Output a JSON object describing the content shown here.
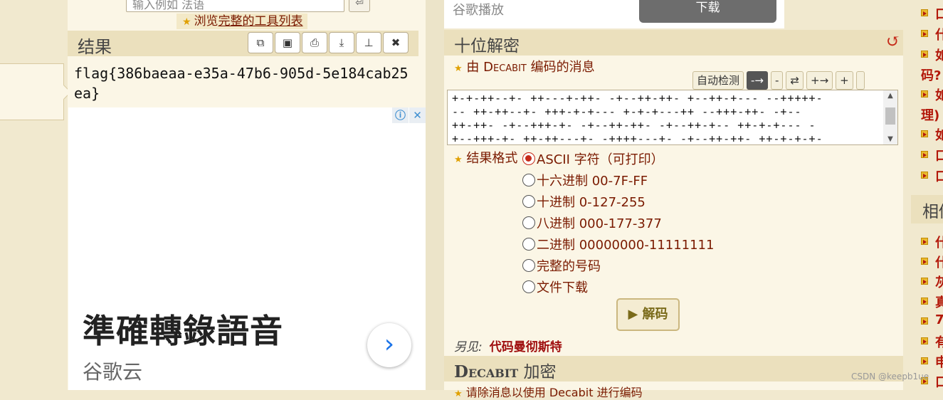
{
  "left_panel": {
    "input_placeholder": "输入例如 法语",
    "input_button_icon": "return-icon",
    "tool_link_prefix": "浏览",
    "tool_link_text": "完整的工具列表",
    "result_title": "结果",
    "result_buttons": [
      "copy-icon",
      "save-icon",
      "print-icon",
      "download-icon",
      "pin-icon",
      "close-icon"
    ],
    "result_text": "flag{386baeaa-e35a-47b6-905d-5e184cab25ea}"
  },
  "ad": {
    "info_icon": "ⓘ",
    "close_icon": "✕",
    "title": "準確轉錄語音",
    "subtitle": "谷歌云",
    "arrow": "›"
  },
  "video_bar": {
    "label": "谷歌播放",
    "download_label": "下载"
  },
  "decode_section": {
    "title": "十位解密",
    "refresh_icon": "↺",
    "message_label_prefix": "由",
    "message_label_brand": "Decabit",
    "message_label_suffix": "编码的消息",
    "controls": {
      "autodetect": "自动检测",
      "arrow_right": "-→",
      "minus": "-",
      "swap": "⇄",
      "plus_arrow": "+→",
      "plus": "+"
    },
    "encoded_text": "+-+-++--+- ++---+-++- -+--++-++- +--++-+--- --+++++-\n-- ++-++--+- +++-+-+--- +-+-+---++ --+++-++- -+--\n++-++- -+--+++-+- -+--++-++- -+--++-+-- ++-+-+--- -\n+--+++-+- ++-++---+- -++++---+- -+--++-++- ++-+-+-+-",
    "format_label": "结果格式",
    "format_options": [
      "ASCII 字符（可打印）",
      "十六进制 00-7F-FF",
      "十进制 0-127-255",
      "八进制 000-177-377",
      "二进制 00000000-11111111",
      "完整的号码",
      "文件下载"
    ],
    "selected_format": 0,
    "decode_button": "▶ 解码",
    "see_also_label": "另见:",
    "see_also_link": "代码曼彻斯特"
  },
  "encode_section": {
    "title_brand": "Decabit",
    "title_suffix": "加密",
    "first_line": "请除消息以使用 Decabit 进行编码"
  },
  "right_sidebar": {
    "top_items": [
      "口",
      "什",
      "如",
      "码?",
      "如",
      "理)",
      "如",
      "口",
      "口"
    ],
    "heading": "相似",
    "bottom_items": [
      "什",
      "什",
      "灰",
      "真",
      "7",
      "有",
      "申",
      "口"
    ]
  },
  "watermark": "CSDN @keepb1ue"
}
